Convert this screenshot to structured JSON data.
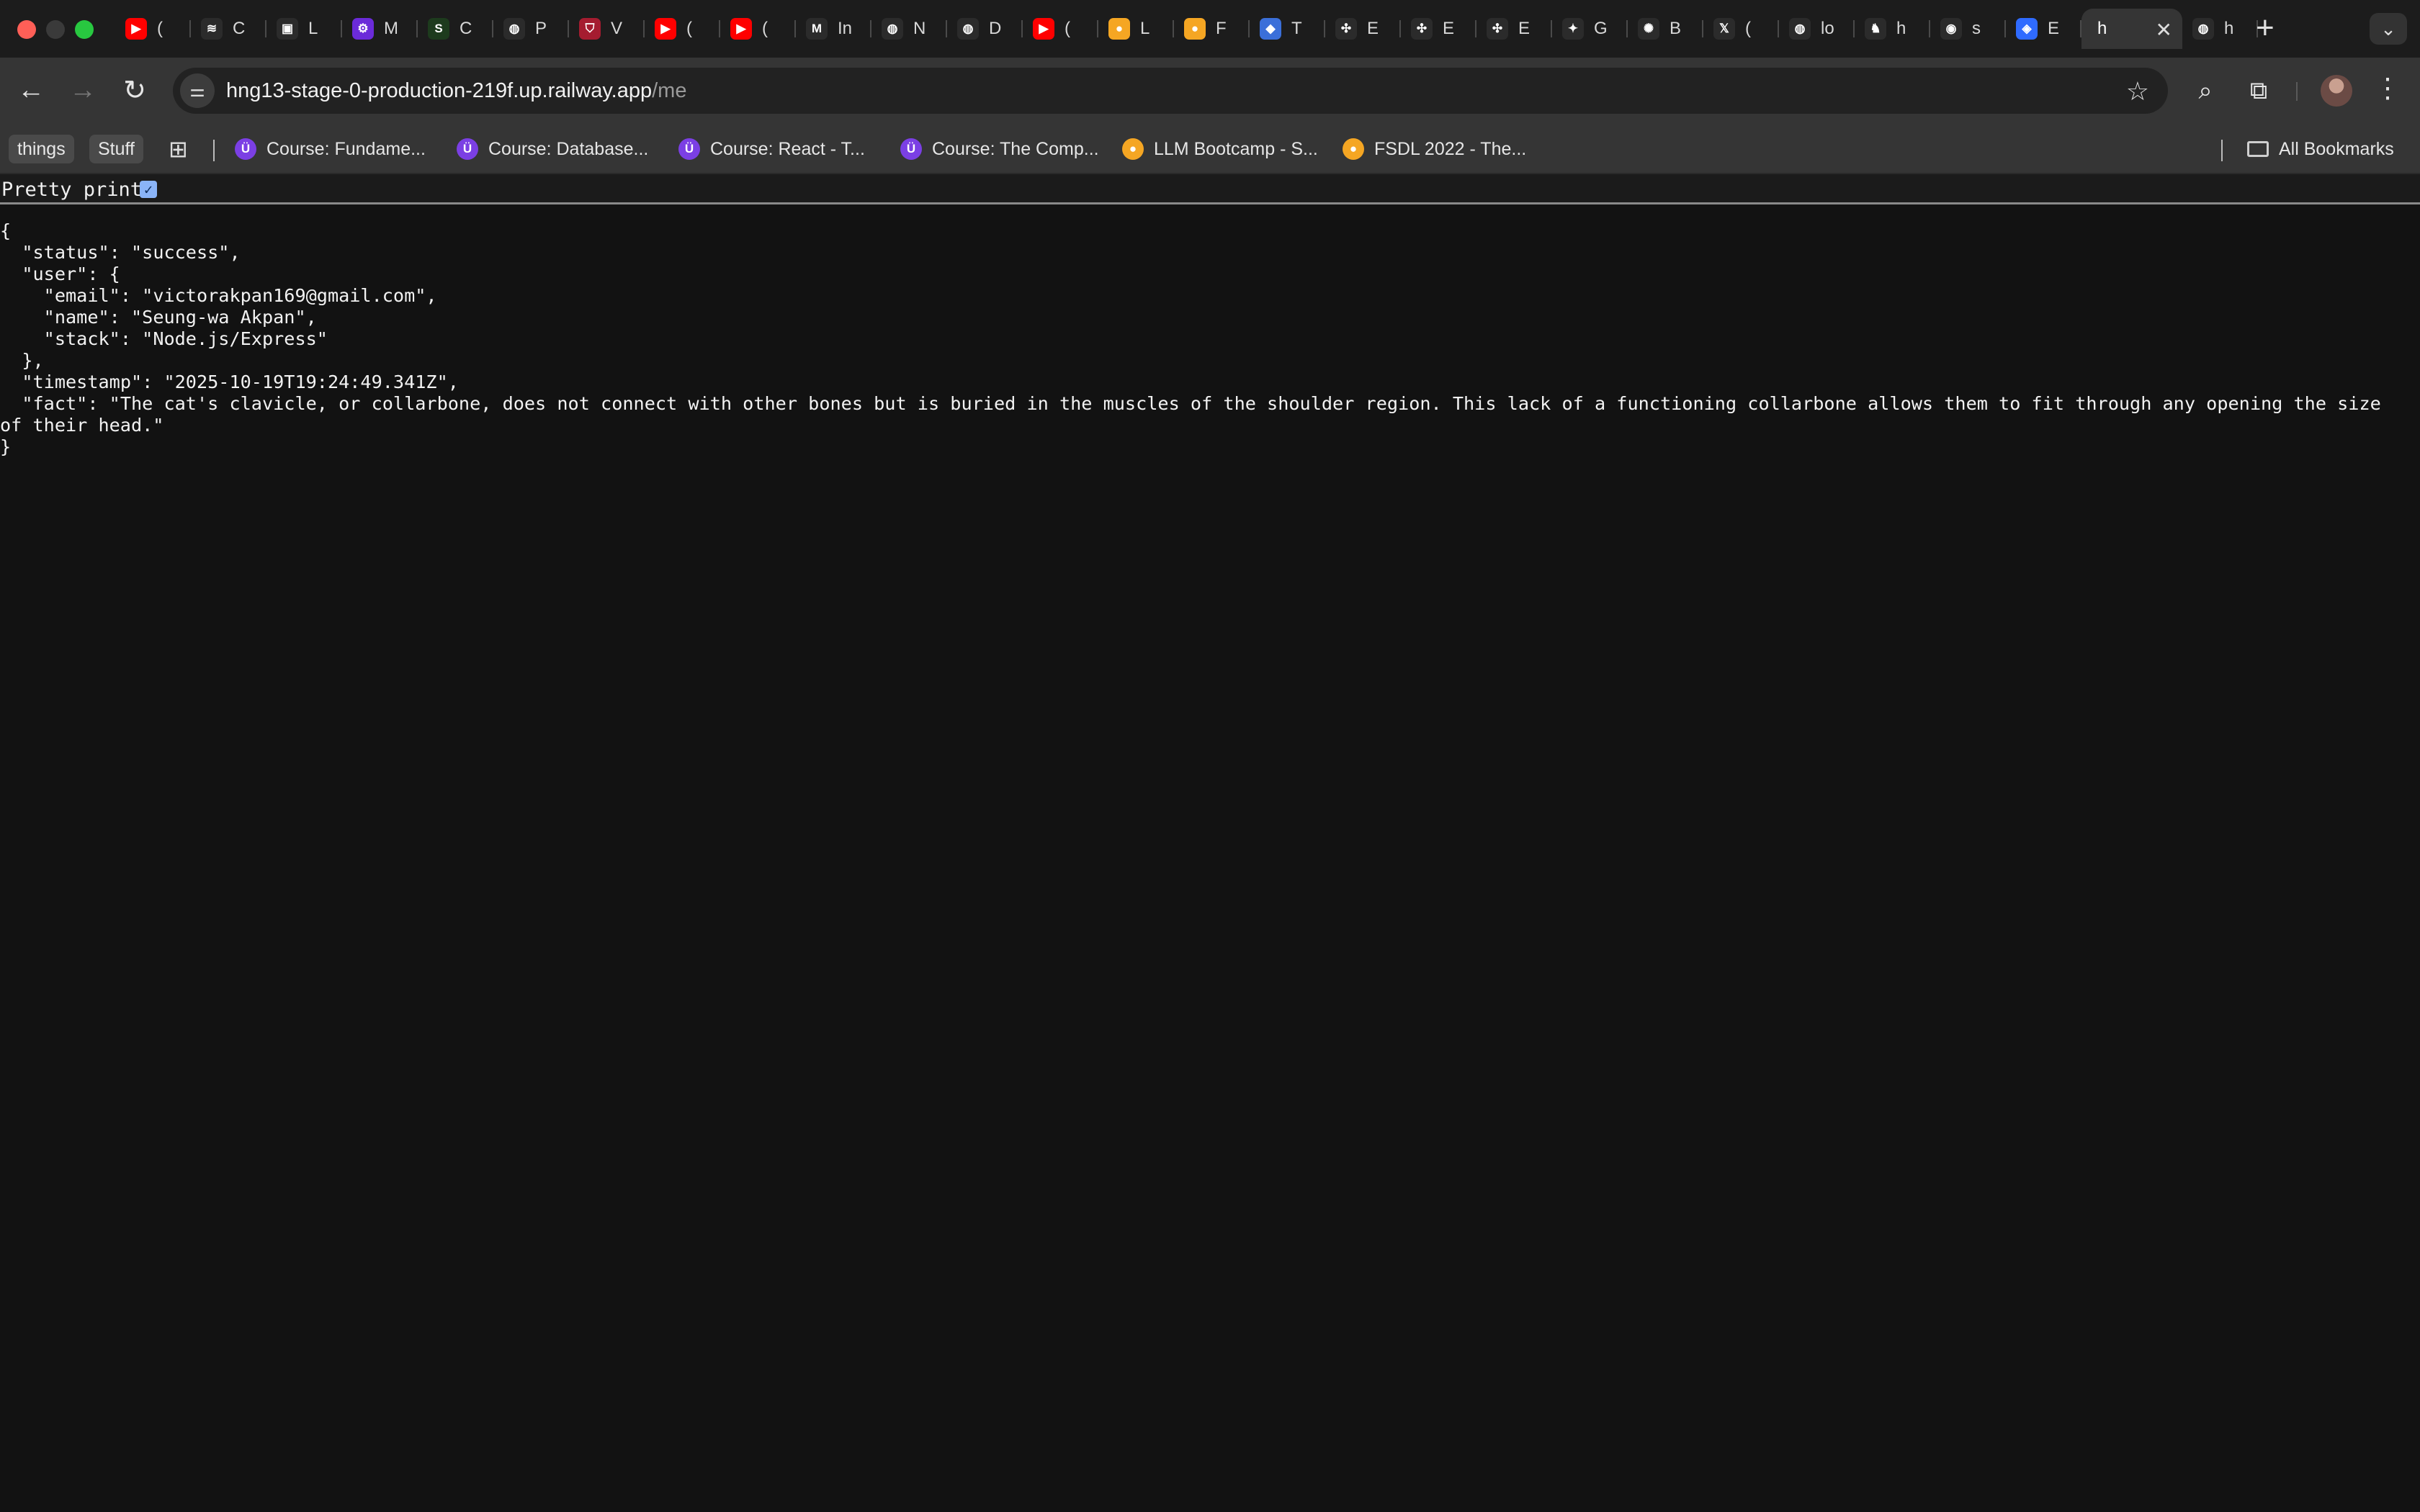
{
  "tabs": [
    {
      "letter": "(",
      "color": "#ff0000",
      "icon": "youtube-icon",
      "glyph": "▶"
    },
    {
      "letter": "C",
      "color": "#2b2b2b",
      "icon": "wave-icon",
      "glyph": "≋"
    },
    {
      "letter": "L",
      "color": "#2b2b2b",
      "icon": "box-icon",
      "glyph": "▣"
    },
    {
      "letter": "M",
      "color": "#6b2bd9",
      "icon": "settings-badge-icon",
      "glyph": "⚙"
    },
    {
      "letter": "C",
      "color": "#1d3b1d",
      "icon": "code-icon",
      "glyph": "S"
    },
    {
      "letter": "P",
      "color": "#2b2b2b",
      "icon": "globe-icon",
      "glyph": "◍"
    },
    {
      "letter": "V",
      "color": "#a51c30",
      "icon": "shield-icon",
      "glyph": "⛉"
    },
    {
      "letter": "(",
      "color": "#ff0000",
      "icon": "youtube-icon",
      "glyph": "▶"
    },
    {
      "letter": "(",
      "color": "#ff0000",
      "icon": "youtube-icon",
      "glyph": "▶"
    },
    {
      "letter": "In",
      "color": "#2b2b2b",
      "icon": "gmail-icon",
      "glyph": "M"
    },
    {
      "letter": "N",
      "color": "#2b2b2b",
      "icon": "globe-icon",
      "glyph": "◍"
    },
    {
      "letter": "D",
      "color": "#2b2b2b",
      "icon": "globe-icon",
      "glyph": "◍"
    },
    {
      "letter": "(",
      "color": "#ff0000",
      "icon": "youtube-icon",
      "glyph": "▶"
    },
    {
      "letter": "L",
      "color": "#f5a623",
      "icon": "pancake-icon",
      "glyph": "●"
    },
    {
      "letter": "F",
      "color": "#f5a623",
      "icon": "pancake-icon",
      "glyph": "●"
    },
    {
      "letter": "T",
      "color": "#3b6fd9",
      "icon": "stack-icon",
      "glyph": "◆"
    },
    {
      "letter": "E",
      "color": "#2b2b2b",
      "icon": "network-icon",
      "glyph": "✣"
    },
    {
      "letter": "E",
      "color": "#2b2b2b",
      "icon": "network-icon",
      "glyph": "✣"
    },
    {
      "letter": "E",
      "color": "#2b2b2b",
      "icon": "network-icon",
      "glyph": "✣"
    },
    {
      "letter": "G",
      "color": "#2b2b2b",
      "icon": "sparkle-icon",
      "glyph": "✦"
    },
    {
      "letter": "B",
      "color": "#2b2b2b",
      "icon": "burst-icon",
      "glyph": "✺"
    },
    {
      "letter": "(",
      "color": "#2b2b2b",
      "icon": "x-logo-icon",
      "glyph": "𝕏"
    },
    {
      "letter": "lo",
      "color": "#2b2b2b",
      "icon": "globe-icon",
      "glyph": "◍"
    },
    {
      "letter": "h",
      "color": "#2b2b2b",
      "icon": "bird-icon",
      "glyph": "♞"
    },
    {
      "letter": "s",
      "color": "#2b2b2b",
      "icon": "github-icon",
      "glyph": "◉"
    },
    {
      "letter": "E",
      "color": "#2f6bff",
      "icon": "diamond-icon",
      "glyph": "◈"
    },
    {
      "letter": "h",
      "color": "#353535",
      "icon": "none",
      "glyph": "",
      "active": true
    },
    {
      "letter": "h",
      "color": "#2b2b2b",
      "icon": "globe-icon",
      "glyph": "◍"
    }
  ],
  "address": {
    "host": "hng13-stage-0-production-219f.up.railway.app",
    "path": "/me"
  },
  "bookmarks": {
    "folders": [
      "things",
      "Stuff"
    ],
    "items": [
      {
        "label": "Course: Fundame...",
        "color": "#7b3fe4",
        "icon": "udemy-icon",
        "glyph": "Ü"
      },
      {
        "label": "Course: Database...",
        "color": "#7b3fe4",
        "icon": "udemy-icon",
        "glyph": "Ü"
      },
      {
        "label": "Course: React - T...",
        "color": "#7b3fe4",
        "icon": "udemy-icon",
        "glyph": "Ü"
      },
      {
        "label": "Course: The Comp...",
        "color": "#7b3fe4",
        "icon": "udemy-icon",
        "glyph": "Ü"
      },
      {
        "label": "LLM Bootcamp - S...",
        "color": "#f5a623",
        "icon": "pancake-icon",
        "glyph": "●"
      },
      {
        "label": "FSDL 2022 - The...",
        "color": "#f5a623",
        "icon": "pancake-icon",
        "glyph": "●"
      }
    ],
    "all_label": "All Bookmarks"
  },
  "content": {
    "pretty_print_label": "Pretty print",
    "pretty_print_checked": true,
    "json_text": "{\n  \"status\": \"success\",\n  \"user\": {\n    \"email\": \"victorakpan169@gmail.com\",\n    \"name\": \"Seung-wa Akpan\",\n    \"stack\": \"Node.js/Express\"\n  },\n  \"timestamp\": \"2025-10-19T19:24:49.341Z\",\n  \"fact\": \"The cat's clavicle, or collarbone, does not connect with other bones but is buried in the muscles of the shoulder region. This lack of a functioning collarbone allows them to fit through any opening the size of their head.\"\n}"
  }
}
